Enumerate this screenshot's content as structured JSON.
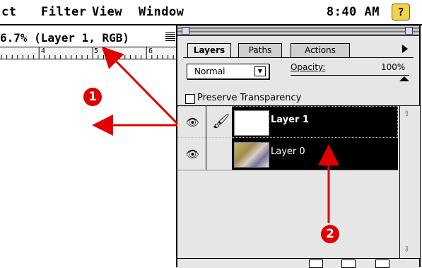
{
  "menubar": {
    "items": [
      "ct",
      "Filter",
      "View",
      "Window"
    ],
    "clock": "8:40 AM",
    "help_icon": "?"
  },
  "document": {
    "title": "6.7% (Layer 1, RGB)",
    "ruler_labels": [
      "4",
      "5",
      "6"
    ]
  },
  "palette": {
    "tabs": [
      "Layers",
      "Paths",
      "Actions"
    ],
    "blend_mode": "Normal",
    "opacity_label": "Opacity:",
    "opacity_value": "100%",
    "preserve_transparency_label": "Preserve Transparency",
    "preserve_transparency_checked": false,
    "layers": [
      {
        "name": "Layer 1",
        "visible": true,
        "active": true,
        "brush_icon": true
      },
      {
        "name": "Layer 0",
        "visible": true,
        "active": false,
        "brush_icon": false
      }
    ]
  },
  "annotations": {
    "badge_1": "1",
    "badge_2": "2",
    "arrow_color": "#e00000"
  }
}
